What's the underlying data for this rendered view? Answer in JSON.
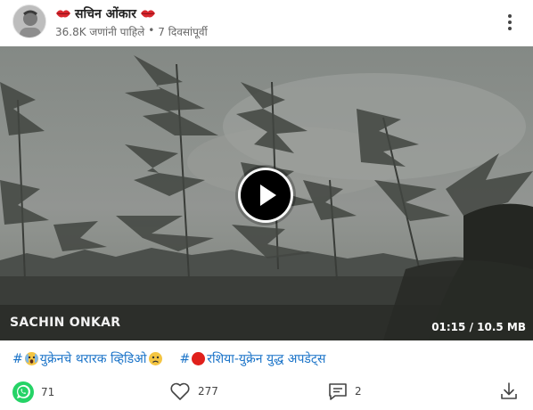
{
  "post": {
    "author": "सचिन ओंकार",
    "views": "36.8K जणांनी पाहिले",
    "separator": "•",
    "time_ago": "7 दिवसांपूर्वी"
  },
  "video": {
    "watermark": "SACHIN ONKAR",
    "duration_size": "01:15 / 10.5 MB"
  },
  "tags": [
    {
      "hash": "#",
      "text": "युक्रेनचे थरारक व्हिडिओ"
    },
    {
      "hash": "#",
      "text": "रशिया-युक्रेन युद्ध अपडेट्स"
    }
  ],
  "actions": {
    "whatsapp_count": "71",
    "like_count": "277",
    "comment_count": "2"
  },
  "colors": {
    "link": "#1a73c8",
    "whatsapp": "#25d366",
    "accent_red": "#e0201b"
  },
  "icons": [
    "lips-emoji-icon",
    "more-vertical-icon",
    "play-icon",
    "whatsapp-icon",
    "heart-icon",
    "comment-icon",
    "download-icon"
  ]
}
